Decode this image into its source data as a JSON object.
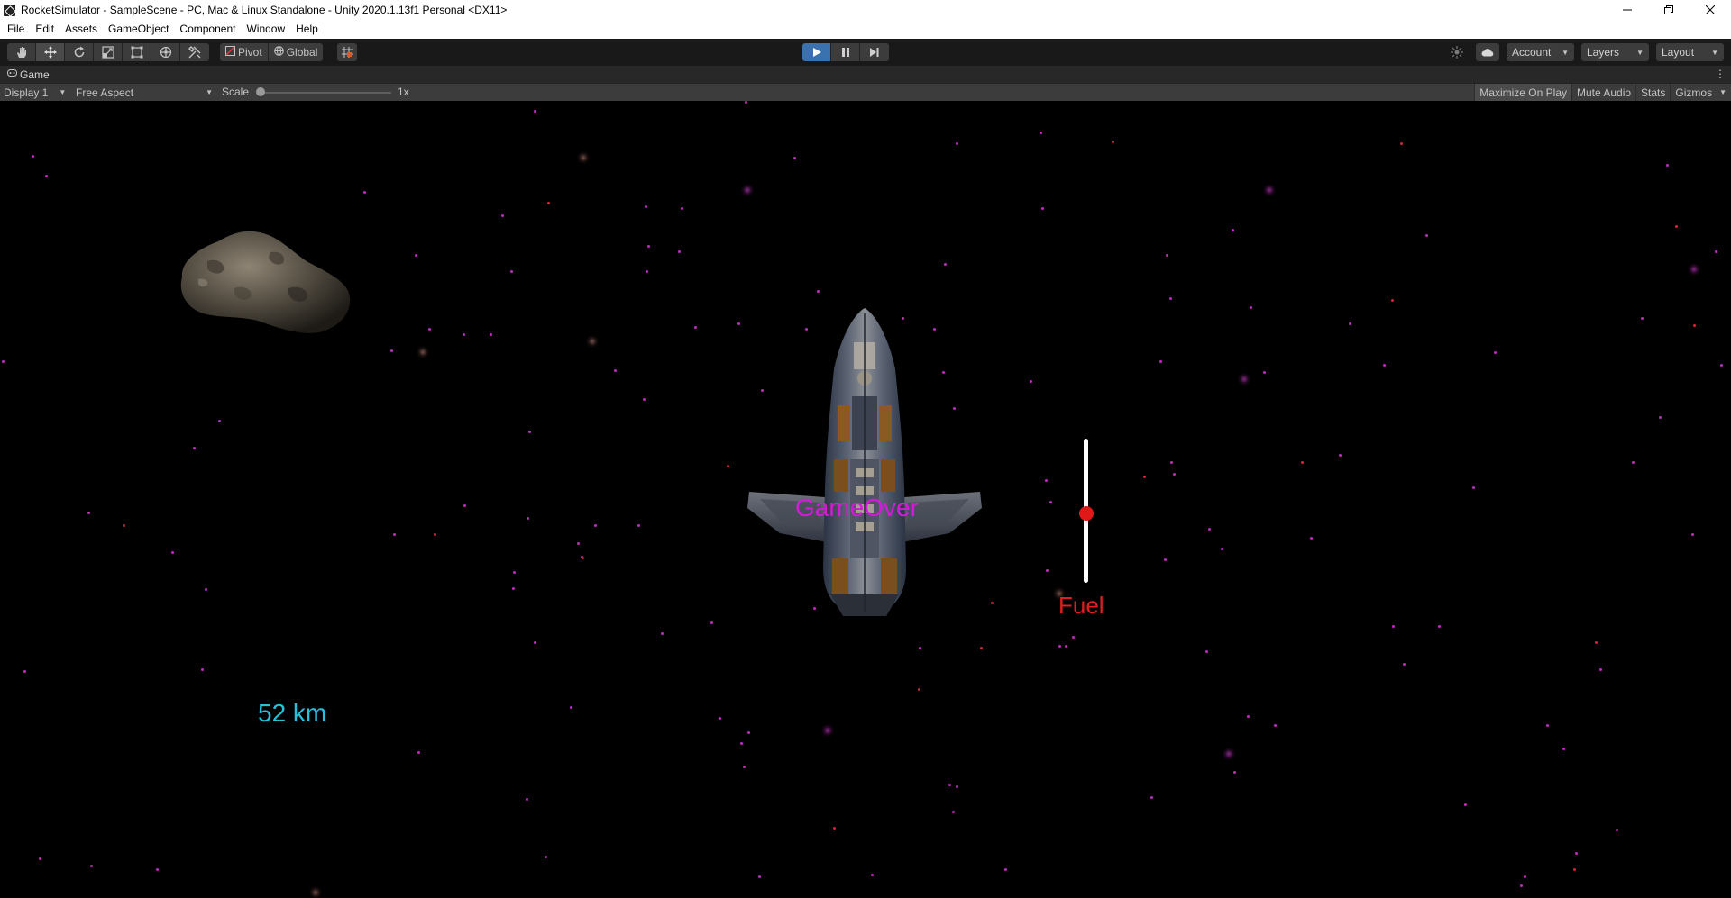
{
  "window": {
    "title": "RocketSimulator - SampleScene - PC, Mac & Linux Standalone - Unity 2020.1.13f1 Personal <DX11>",
    "controls": [
      "minimize-icon",
      "restore-icon",
      "close-icon"
    ]
  },
  "menu": {
    "items": [
      "File",
      "Edit",
      "Assets",
      "GameObject",
      "Component",
      "Window",
      "Help"
    ]
  },
  "toolbar": {
    "tools": [
      "hand-tool-icon",
      "move-tool-icon",
      "rotate-tool-icon",
      "scale-tool-icon",
      "rect-tool-icon",
      "transform-tool-icon",
      "custom-tool-icon"
    ],
    "active_tool": "move-tool-icon",
    "pivot_label": "Pivot",
    "global_label": "Global",
    "grid_snap_icon": "grid-snap-icon",
    "play_state": "playing",
    "account_label": "Account",
    "layers_label": "Layers",
    "layout_label": "Layout"
  },
  "game_tab": {
    "label": "Game"
  },
  "game_bar": {
    "display_label": "Display 1",
    "aspect_label": "Free Aspect",
    "scale_label": "Scale",
    "scale_value": "1x",
    "scale_fraction": 0.0,
    "toggles": [
      {
        "label": "Maximize On Play",
        "on": true
      },
      {
        "label": "Mute Audio",
        "on": false
      },
      {
        "label": "Stats",
        "on": false
      },
      {
        "label": "Gizmos",
        "on": false
      }
    ]
  },
  "game": {
    "status_text": "GameOver",
    "distance_text": "52 km",
    "fuel_label": "Fuel",
    "fuel_level": 0.48,
    "colors": {
      "status": "#d21bd8",
      "distance": "#29c0d8",
      "fuel": "#e31c22",
      "fuel_knob": "#e01818",
      "play_active": "#3a72b0"
    }
  }
}
